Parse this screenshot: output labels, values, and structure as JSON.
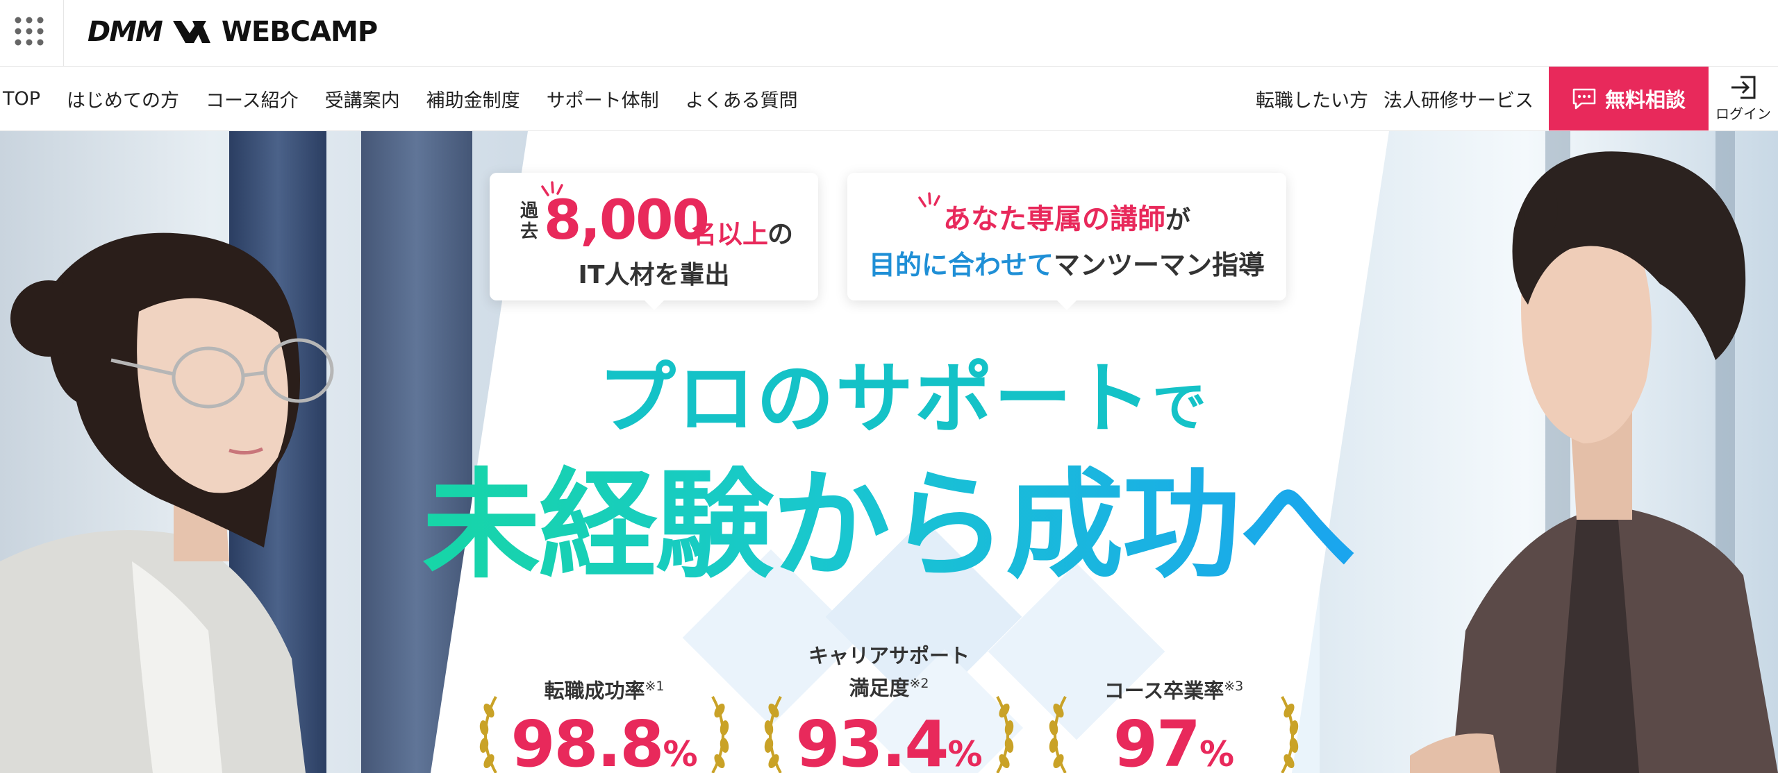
{
  "header": {
    "logo": {
      "dmm": "DMM",
      "webcamp": "WEBCAMP"
    }
  },
  "nav": {
    "left": [
      "TOP",
      "はじめての方",
      "コース紹介",
      "受講案内",
      "補助金制度",
      "サポート体制",
      "よくある質問"
    ],
    "right": [
      "転職したい方",
      "法人研修サービス"
    ],
    "cta_label": "無料相談",
    "login_label": "ログイン"
  },
  "hero": {
    "callout1": {
      "prefix_vertical": "過去",
      "number": "8,000",
      "unit": "名以上",
      "particle": "の",
      "line2": "IT人材を輩出"
    },
    "callout2": {
      "line1_highlight": "あなた専属の講師",
      "line1_suffix": "が",
      "line2_highlight": "目的に合わせて",
      "line2_suffix": "マンツーマン指導"
    },
    "headline1_main": "プロのサポート",
    "headline1_particle": "で",
    "headline2": "未経験から成功へ",
    "stats": [
      {
        "label": "転職成功率",
        "note": "※1",
        "value": "98.8",
        "unit": "%"
      },
      {
        "label_line1": "キャリアサポート",
        "label": "満足度",
        "note": "※2",
        "value": "93.4",
        "unit": "%"
      },
      {
        "label": "コース卒業率",
        "note": "※3",
        "value": "97",
        "unit": "%"
      }
    ]
  },
  "colors": {
    "accent_pink": "#e8295b",
    "teal": "#14c2c7",
    "blue": "#1f8fd6",
    "gold": "#c9a227"
  }
}
